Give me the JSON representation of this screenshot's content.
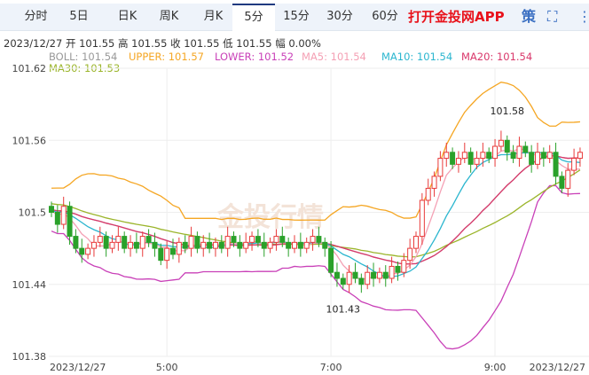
{
  "tabs": [
    "分时",
    "5日",
    "日K",
    "周K",
    "月K",
    "5分",
    "15分",
    "30分",
    "60分"
  ],
  "active_tab": "5分",
  "promo": "打开金投网APP",
  "strategy_label": "策",
  "info": {
    "date": "2023/12/27",
    "open_label": "开",
    "open": "101.55",
    "high_label": "高",
    "high": "101.55",
    "close_label": "收",
    "close": "101.55",
    "low_label": "低",
    "low": "101.55",
    "change_label": "幅",
    "change": "0.00%"
  },
  "legend": {
    "boll": "BOLL: 101.54",
    "upper": "UPPER: 101.57",
    "lower": "LOWER: 101.52",
    "ma5": "MA5: 101.54",
    "ma10": "MA10: 101.54",
    "ma20": "MA20: 101.54",
    "ma30": "MA30: 101.53"
  },
  "colors": {
    "upper": "#f5a623",
    "lower": "#c940b8",
    "boll": "#aaaaaa",
    "ma5": "#f4a0b4",
    "ma10": "#2bb6cf",
    "ma20": "#d9376a",
    "ma30": "#9bb52b",
    "up": "#e83a3a",
    "down": "#2aa12a"
  },
  "watermark": "金投行情",
  "chart_data": {
    "type": "candlestick",
    "yticks": [
      "101.62",
      "101.56",
      "101.5",
      "101.44",
      "101.38"
    ],
    "ylim": [
      101.38,
      101.62
    ],
    "xticks": [
      {
        "label": "2023/12/27",
        "i": 0
      },
      {
        "label": "5:00",
        "i": 19
      },
      {
        "label": "7:00",
        "i": 46
      },
      {
        "label": "9:00",
        "i": 73
      },
      {
        "label": "2023/12/27",
        "i": 87
      }
    ],
    "annotations": [
      {
        "label": "101.58",
        "i": 75,
        "value": 101.58
      },
      {
        "label": "101.43",
        "i": 48,
        "value": 101.43
      }
    ],
    "closes": [
      101.5,
      101.49,
      101.505,
      101.48,
      101.47,
      101.465,
      101.47,
      101.475,
      101.48,
      101.47,
      101.475,
      101.48,
      101.47,
      101.475,
      101.47,
      101.48,
      101.475,
      101.47,
      101.46,
      101.47,
      101.465,
      101.475,
      101.47,
      101.48,
      101.47,
      101.475,
      101.47,
      101.475,
      101.47,
      101.48,
      101.475,
      101.47,
      101.475,
      101.48,
      101.475,
      101.47,
      101.475,
      101.48,
      101.475,
      101.47,
      101.475,
      101.47,
      101.475,
      101.48,
      101.475,
      101.47,
      101.45,
      101.445,
      101.44,
      101.45,
      101.445,
      101.44,
      101.45,
      101.445,
      101.45,
      101.445,
      101.455,
      101.45,
      101.46,
      101.47,
      101.48,
      101.51,
      101.52,
      101.53,
      101.545,
      101.55,
      101.54,
      101.545,
      101.55,
      101.54,
      101.545,
      101.55,
      101.545,
      101.555,
      101.56,
      101.55,
      101.545,
      101.555,
      101.55,
      101.54,
      101.55,
      101.545,
      101.55,
      101.53,
      101.52,
      101.535,
      101.545,
      101.55
    ]
  }
}
